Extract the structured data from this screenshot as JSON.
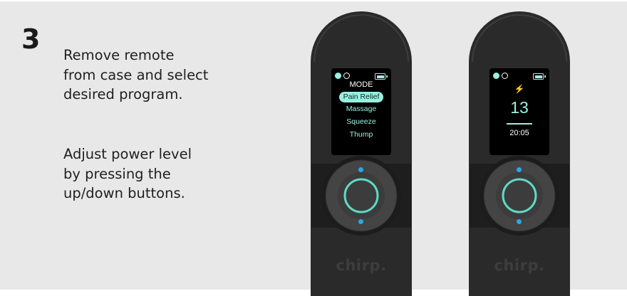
{
  "step": {
    "number": "3"
  },
  "instructions": {
    "paragraph1": [
      "Remove remote",
      "from case and select",
      "desired program."
    ],
    "paragraph2": [
      "Adjust power level",
      "by pressing the",
      "up/down buttons."
    ]
  },
  "remote_left": {
    "brand": "chirp.",
    "screen": {
      "title": "MODE",
      "programs": [
        "Pain Relief",
        "Massage",
        "Squeeze",
        "Thump"
      ],
      "selected_program": "Pain Relief",
      "indicator_icons": [
        "filled-dot-icon",
        "empty-dot-icon",
        "battery-icon"
      ]
    }
  },
  "remote_right": {
    "brand": "chirp.",
    "screen": {
      "icon": "lightning-bolt-icon",
      "bolt_glyph": "⚡",
      "power_level": "13",
      "timer": "20:05",
      "indicator_icons": [
        "filled-dot-icon",
        "empty-dot-icon",
        "battery-icon"
      ]
    }
  },
  "colors": {
    "background": "#e8e8e8",
    "device_body": "#2a2a2a",
    "screen_accent": "#9af0e0",
    "button_ring": "#5fd9c4",
    "nub_blue": "#2aa7e6"
  }
}
